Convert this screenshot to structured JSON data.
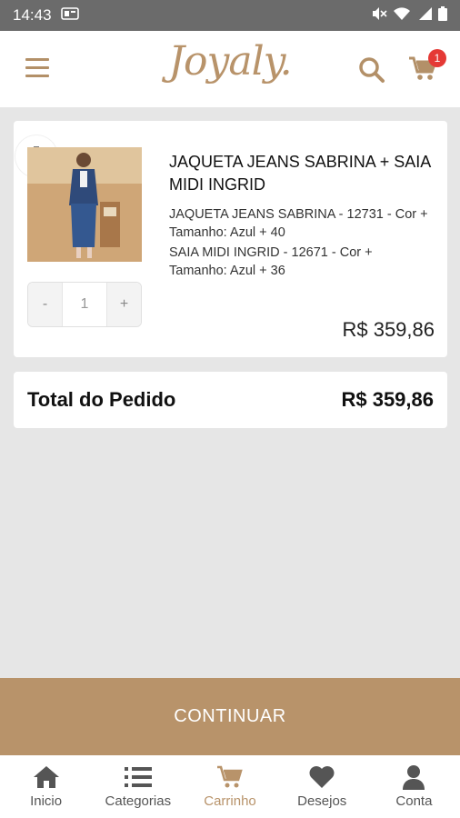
{
  "status_bar": {
    "time": "14:43"
  },
  "header": {
    "logo": "Joyaly.",
    "cart_count": "1"
  },
  "cart_item": {
    "title": "JAQUETA JEANS SABRINA + SAIA MIDI INGRID",
    "variant_1": "JAQUETA JEANS SABRINA - 12731 - Cor + Tamanho: Azul + 40",
    "variant_2": "SAIA MIDI INGRID - 12671 - Cor + Tamanho: Azul + 36",
    "price": "R$  359,86",
    "quantity": "1",
    "decrement_label": "-",
    "increment_label": "+"
  },
  "total": {
    "label": "Total do Pedido",
    "value": "R$  359,86"
  },
  "continue_label": "CONTINUAR",
  "nav": {
    "items": [
      {
        "label": "Inicio",
        "icon": "home-icon"
      },
      {
        "label": "Categorias",
        "icon": "list-icon"
      },
      {
        "label": "Carrinho",
        "icon": "cart-icon"
      },
      {
        "label": "Desejos",
        "icon": "heart-icon"
      },
      {
        "label": "Conta",
        "icon": "user-icon"
      }
    ],
    "active": "Carrinho"
  },
  "colors": {
    "accent": "#b8936a",
    "badge": "#e53935",
    "background": "#e6e6e6"
  }
}
